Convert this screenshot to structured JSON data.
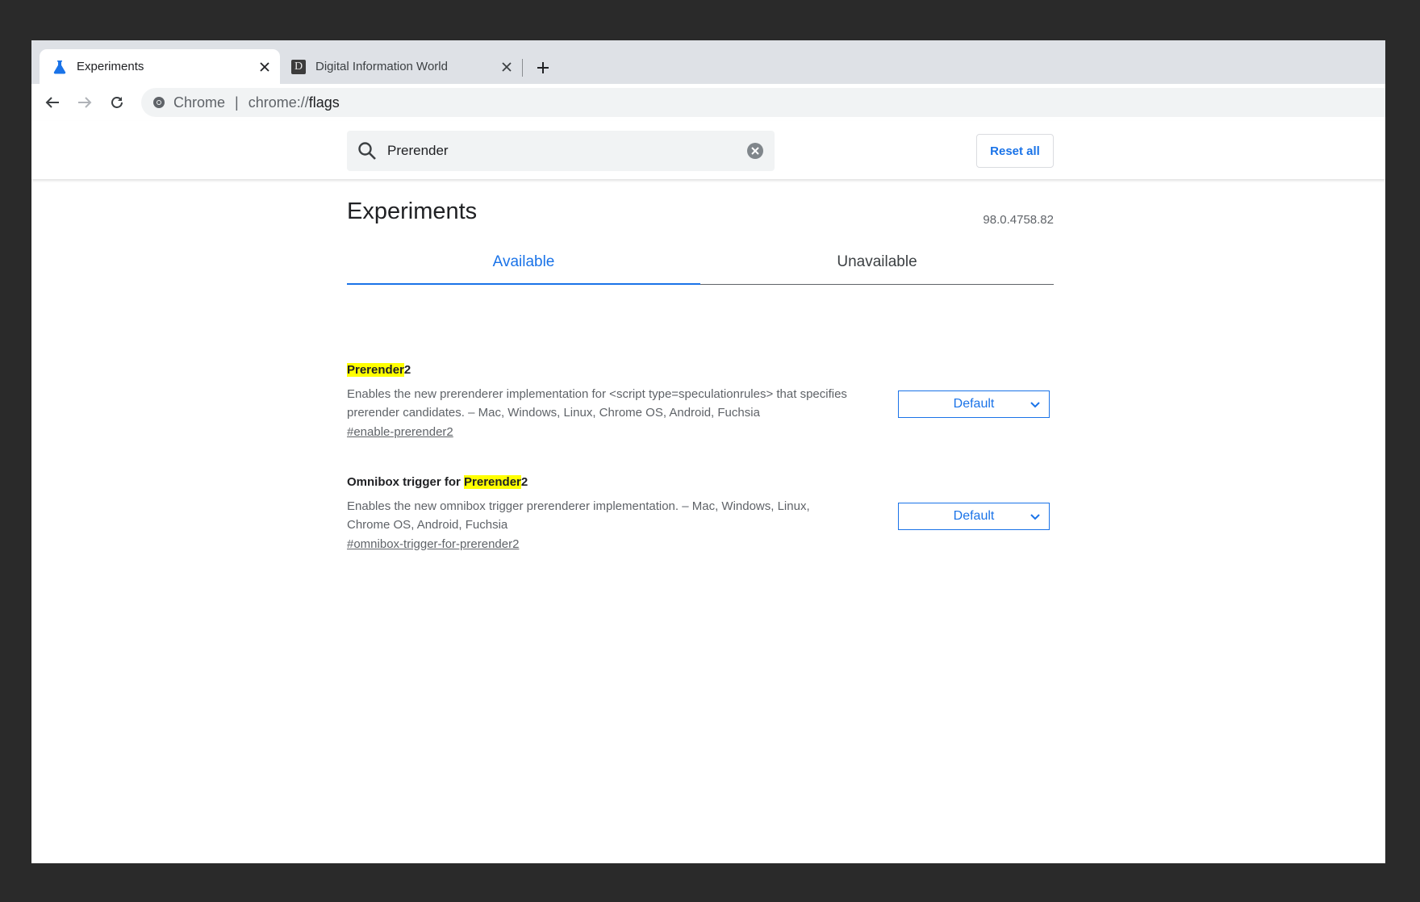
{
  "browser": {
    "tabs": [
      {
        "title": "Experiments",
        "icon": "flask-icon",
        "active": true
      },
      {
        "title": "Digital Information World",
        "icon": "d-favicon",
        "favicon_letter": "D",
        "active": false
      }
    ],
    "address": {
      "site_label": "Chrome",
      "separator": "|",
      "url_scheme": "chrome://",
      "url_path": "flags"
    }
  },
  "header": {
    "search_value": "Prerender",
    "reset_label": "Reset all"
  },
  "main": {
    "title": "Experiments",
    "version": "98.0.4758.82",
    "tabs": [
      {
        "label": "Available",
        "selected": true
      },
      {
        "label": "Unavailable",
        "selected": false
      }
    ],
    "experiments": [
      {
        "name_prefix": "",
        "name_highlight": "Prerender",
        "name_suffix": "2",
        "description": "Enables the new prerenderer implementation for <script type=speculationrules> that specifies prerender candidates. – Mac, Windows, Linux, Chrome OS, Android, Fuchsia",
        "link": "#enable-prerender2",
        "select_value": "Default"
      },
      {
        "name_prefix": "Omnibox trigger for ",
        "name_highlight": "Prerender",
        "name_suffix": "2",
        "description": "Enables the new omnibox trigger prerenderer implementation. – Mac, Windows, Linux, Chrome OS, Android, Fuchsia",
        "link": "#omnibox-trigger-for-prerender2",
        "select_value": "Default"
      }
    ]
  },
  "colors": {
    "accent": "#1a73e8",
    "highlight": "#ffff00",
    "backdrop": "#2a2a2a"
  }
}
